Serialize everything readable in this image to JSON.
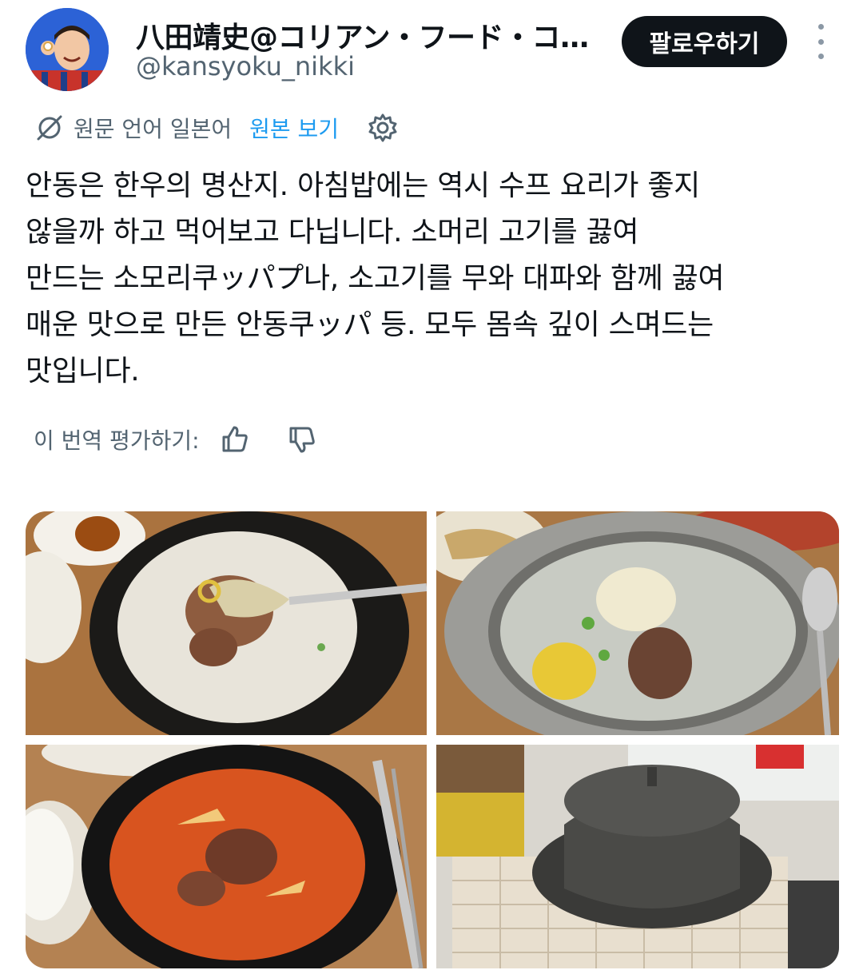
{
  "author": {
    "display_name": "八田靖史@コリアン・フード・コラ...",
    "handle": "@kansyoku_nikki"
  },
  "follow_button": {
    "label": "팔로우하기"
  },
  "translation": {
    "original_language": "원문 언어 일본어",
    "show_original": "원본 보기"
  },
  "tweet": {
    "text": "안동은 한우의 명산지. 아침밥에는 역시 수프 요리가 좋지\n않을까 하고 먹어보고 다닙니다. 소머리 고기를 끓여\n만드는 소모리쿠ッパプ나, 소고기를 무와 대파와 함께 끓여\n매운 맛으로 만든 안동쿠ッパ 등. 모두 몸속 깊이 스며드는\n맛입니다."
  },
  "rating": {
    "label": "이 번역 평가하기:"
  },
  "colors": {
    "text_primary": "#0f1419",
    "text_secondary": "#536471",
    "link": "#1d9bf0",
    "button_bg": "#0f1419"
  },
  "icons": [
    "translate-off-icon",
    "gear-icon",
    "thumbs-up-icon",
    "thumbs-down-icon",
    "more-icon"
  ]
}
